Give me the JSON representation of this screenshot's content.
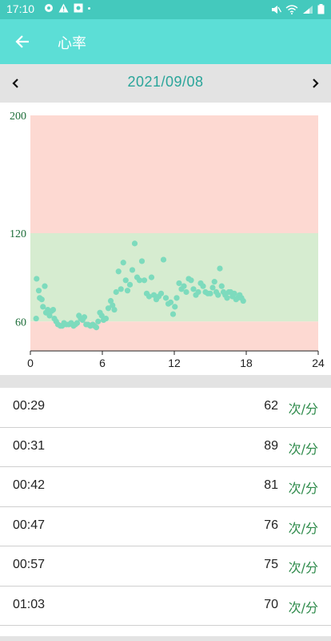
{
  "status_bar": {
    "time": "17:10",
    "icons": [
      "notification-icon",
      "warning-icon",
      "image-icon",
      "mute-icon",
      "wifi-icon",
      "signal-icon",
      "battery-icon"
    ]
  },
  "app_bar": {
    "title": "心率",
    "back_icon": "arrow-left-icon"
  },
  "date_nav": {
    "date": "2021/09/08",
    "prev_icon": "chevron-left-icon",
    "next_icon": "chevron-right-icon"
  },
  "colors": {
    "status_bar": "#44c9bd",
    "app_bar": "#5cded6",
    "accent_text": "#2aa59a",
    "unit_text": "#2d8a4a",
    "high_zone": "#fdd9d2",
    "normal_zone": "#d6ecd0",
    "points": "#7ddbbd"
  },
  "chart_data": {
    "type": "scatter",
    "xlim": [
      0,
      24
    ],
    "ylim": [
      40,
      200
    ],
    "x_ticks": [
      "0",
      "6",
      "12",
      "18",
      "24"
    ],
    "y_ticks": [
      "200",
      "120",
      "60"
    ],
    "y_tick_values": [
      200,
      120,
      60
    ],
    "zones": [
      {
        "from": 120,
        "to": 200,
        "color": "#fdd9d2"
      },
      {
        "from": 60,
        "to": 120,
        "color": "#d6ecd0"
      },
      {
        "from": 40,
        "to": 60,
        "color": "#fdd9d2"
      }
    ],
    "points": [
      [
        0.48,
        62
      ],
      [
        0.52,
        89
      ],
      [
        0.7,
        81
      ],
      [
        0.78,
        76
      ],
      [
        0.95,
        75
      ],
      [
        1.05,
        70
      ],
      [
        1.2,
        84
      ],
      [
        1.3,
        66
      ],
      [
        1.45,
        68
      ],
      [
        1.6,
        64
      ],
      [
        1.75,
        67
      ],
      [
        1.9,
        68
      ],
      [
        2.0,
        62
      ],
      [
        2.15,
        60
      ],
      [
        2.3,
        58
      ],
      [
        2.5,
        57
      ],
      [
        2.65,
        57
      ],
      [
        2.8,
        59
      ],
      [
        3.0,
        58
      ],
      [
        3.2,
        58
      ],
      [
        3.4,
        59
      ],
      [
        3.6,
        57
      ],
      [
        3.75,
        58
      ],
      [
        3.9,
        59
      ],
      [
        4.05,
        64
      ],
      [
        4.2,
        62
      ],
      [
        4.35,
        61
      ],
      [
        4.5,
        63
      ],
      [
        4.65,
        58
      ],
      [
        4.8,
        58
      ],
      [
        5.0,
        57
      ],
      [
        5.2,
        58
      ],
      [
        5.35,
        57
      ],
      [
        5.5,
        56
      ],
      [
        5.65,
        60
      ],
      [
        5.8,
        66
      ],
      [
        5.95,
        64
      ],
      [
        6.1,
        61
      ],
      [
        6.3,
        62
      ],
      [
        6.5,
        69
      ],
      [
        6.7,
        74
      ],
      [
        6.85,
        71
      ],
      [
        7.0,
        68
      ],
      [
        7.15,
        80
      ],
      [
        7.35,
        94
      ],
      [
        7.55,
        82
      ],
      [
        7.75,
        100
      ],
      [
        7.95,
        88
      ],
      [
        8.1,
        81
      ],
      [
        8.3,
        85
      ],
      [
        8.5,
        95
      ],
      [
        8.7,
        113
      ],
      [
        8.9,
        90
      ],
      [
        9.1,
        88
      ],
      [
        9.3,
        101
      ],
      [
        9.5,
        88
      ],
      [
        9.7,
        79
      ],
      [
        9.9,
        77
      ],
      [
        10.1,
        90
      ],
      [
        10.3,
        78
      ],
      [
        10.5,
        75
      ],
      [
        10.7,
        77
      ],
      [
        10.9,
        79
      ],
      [
        11.1,
        102
      ],
      [
        11.3,
        76
      ],
      [
        11.5,
        72
      ],
      [
        11.7,
        73
      ],
      [
        11.9,
        65
      ],
      [
        12.05,
        70
      ],
      [
        12.2,
        76
      ],
      [
        12.4,
        86
      ],
      [
        12.6,
        82
      ],
      [
        12.8,
        84
      ],
      [
        13.0,
        80
      ],
      [
        13.2,
        89
      ],
      [
        13.4,
        88
      ],
      [
        13.6,
        82
      ],
      [
        13.8,
        78
      ],
      [
        14.0,
        80
      ],
      [
        14.2,
        86
      ],
      [
        14.4,
        84
      ],
      [
        14.6,
        80
      ],
      [
        14.8,
        79
      ],
      [
        15.0,
        79
      ],
      [
        15.2,
        83
      ],
      [
        15.35,
        87
      ],
      [
        15.5,
        80
      ],
      [
        15.65,
        78
      ],
      [
        15.8,
        96
      ],
      [
        15.95,
        84
      ],
      [
        16.1,
        80
      ],
      [
        16.25,
        78
      ],
      [
        16.4,
        76
      ],
      [
        16.55,
        80
      ],
      [
        16.7,
        80
      ],
      [
        16.85,
        77
      ],
      [
        17.0,
        79
      ],
      [
        17.15,
        75
      ],
      [
        17.3,
        76
      ],
      [
        17.45,
        78
      ],
      [
        17.6,
        76
      ],
      [
        17.75,
        74
      ]
    ]
  },
  "readings": [
    {
      "time": "00:29",
      "value": "62",
      "unit": "次/分"
    },
    {
      "time": "00:31",
      "value": "89",
      "unit": "次/分"
    },
    {
      "time": "00:42",
      "value": "81",
      "unit": "次/分"
    },
    {
      "time": "00:47",
      "value": "76",
      "unit": "次/分"
    },
    {
      "time": "00:57",
      "value": "75",
      "unit": "次/分"
    },
    {
      "time": "01:03",
      "value": "70",
      "unit": "次/分"
    }
  ]
}
